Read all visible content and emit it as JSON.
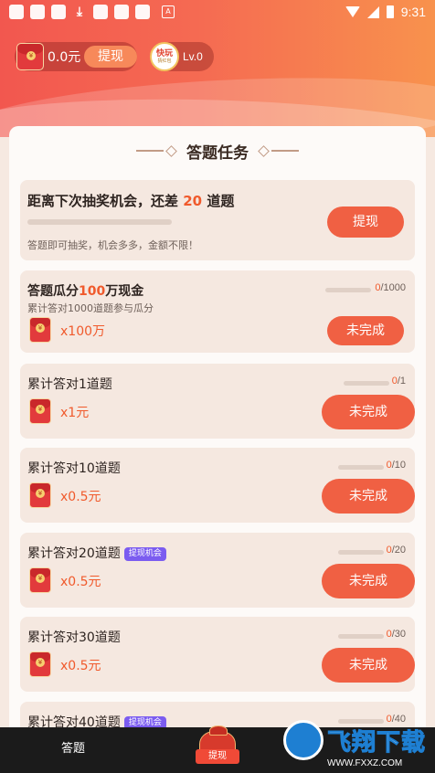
{
  "status_bar": {
    "time": "9:31",
    "notif_box_label": "A"
  },
  "header": {
    "balance": "0.0元",
    "withdraw_label": "提现",
    "level_badge_line1": "快玩",
    "level_badge_line2": "猜红包",
    "level": "Lv.0"
  },
  "panel": {
    "title": "答题任务"
  },
  "lottery": {
    "title_prefix": "距离下次抽奖机会，还差 ",
    "remaining": "20",
    "title_suffix": " 道题",
    "subtitle": "答题即可抽奖，机会多多，金额不限！",
    "button": "提现"
  },
  "tasks": [
    {
      "title_a": "答题瓜分",
      "title_hl": "100",
      "title_b": "万现金",
      "desc": "累计答对1000道题参与瓜分",
      "done": "0",
      "total": "/1000",
      "reward": "x100万",
      "status": "未完成"
    },
    {
      "title": "累计答对1道题",
      "done": "0",
      "total": "/1",
      "reward": "x1元",
      "status": "未完成"
    },
    {
      "title": "累计答对10道题",
      "done": "0",
      "total": "/10",
      "reward": "x0.5元",
      "status": "未完成"
    },
    {
      "title": "累计答对20道题",
      "tag": "提现机会",
      "done": "0",
      "total": "/20",
      "reward": "x0.5元",
      "status": "未完成"
    },
    {
      "title": "累计答对30道题",
      "done": "0",
      "total": "/30",
      "reward": "x0.5元",
      "status": "未完成"
    },
    {
      "title": "累计答对40道题",
      "tag": "提现机会",
      "done": "0",
      "total": "/40"
    }
  ],
  "envelope_symbol": "¥",
  "bottom_nav": {
    "left": "答题",
    "center": "提现"
  },
  "watermark": {
    "text": "飞翔下载",
    "url": "WWW.FXXZ.COM"
  },
  "colors": {
    "accent": "#f06043",
    "header_start": "#f2574f",
    "header_end": "#f8924d",
    "tag": "#7b5cf0"
  }
}
